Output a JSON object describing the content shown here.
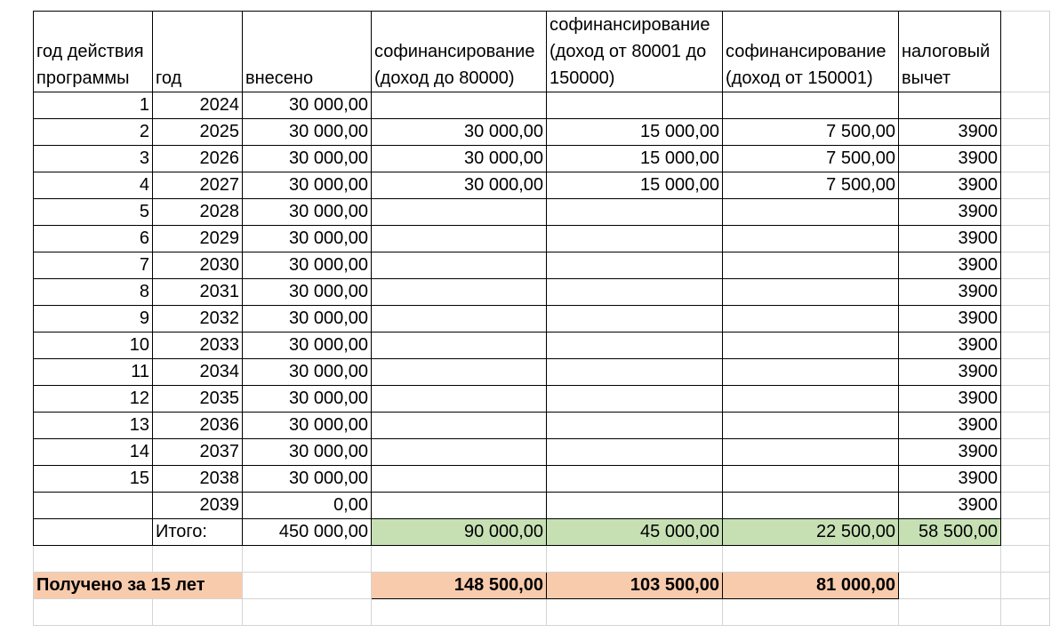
{
  "headers": [
    "год действия программы",
    "год",
    "внесено",
    "софинансирование (доход до 80000)",
    "софинансирование (доход от 80001 до 150000)",
    "софинансирование (доход от 150001)",
    "налоговый вычет"
  ],
  "rows": [
    [
      "1",
      "2024",
      "30 000,00",
      "",
      "",
      "",
      ""
    ],
    [
      "2",
      "2025",
      "30 000,00",
      "30 000,00",
      "15 000,00",
      "7 500,00",
      "3900"
    ],
    [
      "3",
      "2026",
      "30 000,00",
      "30 000,00",
      "15 000,00",
      "7 500,00",
      "3900"
    ],
    [
      "4",
      "2027",
      "30 000,00",
      "30 000,00",
      "15 000,00",
      "7 500,00",
      "3900"
    ],
    [
      "5",
      "2028",
      "30 000,00",
      "",
      "",
      "",
      "3900"
    ],
    [
      "6",
      "2029",
      "30 000,00",
      "",
      "",
      "",
      "3900"
    ],
    [
      "7",
      "2030",
      "30 000,00",
      "",
      "",
      "",
      "3900"
    ],
    [
      "8",
      "2031",
      "30 000,00",
      "",
      "",
      "",
      "3900"
    ],
    [
      "9",
      "2032",
      "30 000,00",
      "",
      "",
      "",
      "3900"
    ],
    [
      "10",
      "2033",
      "30 000,00",
      "",
      "",
      "",
      "3900"
    ],
    [
      "11",
      "2034",
      "30 000,00",
      "",
      "",
      "",
      "3900"
    ],
    [
      "12",
      "2035",
      "30 000,00",
      "",
      "",
      "",
      "3900"
    ],
    [
      "13",
      "2036",
      "30 000,00",
      "",
      "",
      "",
      "3900"
    ],
    [
      "14",
      "2037",
      "30 000,00",
      "",
      "",
      "",
      "3900"
    ],
    [
      "15",
      "2038",
      "30 000,00",
      "",
      "",
      "",
      "3900"
    ],
    [
      "",
      "2039",
      "0,00",
      "",
      "",
      "",
      "3900"
    ]
  ],
  "total": {
    "label": "Итого:",
    "contributed": "450 000,00",
    "cofin_low": "90 000,00",
    "cofin_mid": "45 000,00",
    "cofin_high": "22 500,00",
    "tax": "58 500,00"
  },
  "received": {
    "label": "Получено за 15 лет",
    "low": "148 500,00",
    "mid": "103 500,00",
    "high": "81 000,00"
  },
  "colors": {
    "total_fill": "#c6e0b4",
    "received_fill": "#f8cbad",
    "gridline": "#d4d4d4",
    "border": "#000000"
  }
}
